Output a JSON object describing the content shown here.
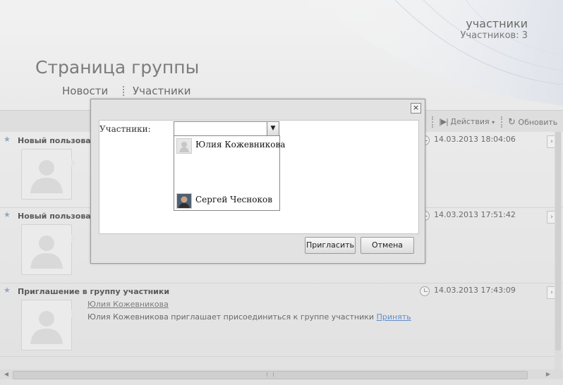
{
  "header": {
    "group_name": "участники",
    "members_count": "Участников: 3",
    "page_title": "Страница группы"
  },
  "nav": {
    "tabs": [
      {
        "label": "Новости"
      },
      {
        "label": "Участники"
      }
    ]
  },
  "toolbar": {
    "actions_label": "Действия",
    "refresh_label": "Обновить"
  },
  "feed": {
    "items": [
      {
        "title": "Новый пользоват",
        "date": "14.03.2013 18:04:06"
      },
      {
        "title": "Новый пользоват",
        "date": "14.03.2013 17:51:42"
      },
      {
        "title": "Приглашение в группу участники",
        "date": "14.03.2013 17:43:09",
        "author": "Юлия Кожевникова",
        "text": "Юлия Кожевникова приглашает присоединиться к группе участники",
        "link": "Принять"
      }
    ]
  },
  "dialog": {
    "label": "Участники:",
    "combo_value": "",
    "options": [
      {
        "name": "Юлия Кожевникова"
      },
      {
        "name": "Сергей Чесноков"
      }
    ],
    "invite_label": "Пригласить",
    "cancel_label": "Отмена"
  },
  "colors": {
    "link": "#4a7ec4",
    "star": "#8a9bb5"
  }
}
